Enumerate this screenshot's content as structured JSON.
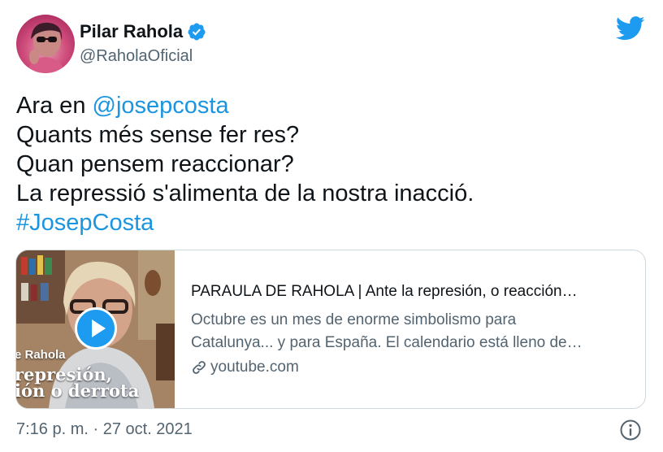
{
  "author": {
    "display_name": "Pilar Rahola",
    "handle": "@RaholaOficial",
    "verified": true,
    "avatar_icon": "profile-photo"
  },
  "tweet": {
    "line1_prefix": "Ara en ",
    "mention": "@josepcosta",
    "line2": "Quants més sense fer res?",
    "line3": "Quan pensem reaccionar?",
    "line4": "La repressió s'alimenta de la nostra inacció.",
    "hashtag": "#JosepCosta"
  },
  "card": {
    "thumbnail_text": [
      "e Rahola",
      "represión,",
      "ión o derrota"
    ],
    "title": "PARAULA DE RAHOLA | Ante la represión, o reacción…",
    "description_line1": "Octubre es un mes de enorme simbolismo para",
    "description_line2": "Catalunya... y para España. El calendario está lleno de…",
    "domain": "youtube.com"
  },
  "footer": {
    "timestamp": "7:16 p. m. · 27 oct. 2021"
  },
  "colors": {
    "link": "#1b95e0",
    "twitter_blue": "#1d9bf0",
    "secondary_text": "#536471"
  },
  "icons": [
    "verified-badge-icon",
    "twitter-bird-icon",
    "play-icon",
    "link-icon",
    "info-icon"
  ]
}
